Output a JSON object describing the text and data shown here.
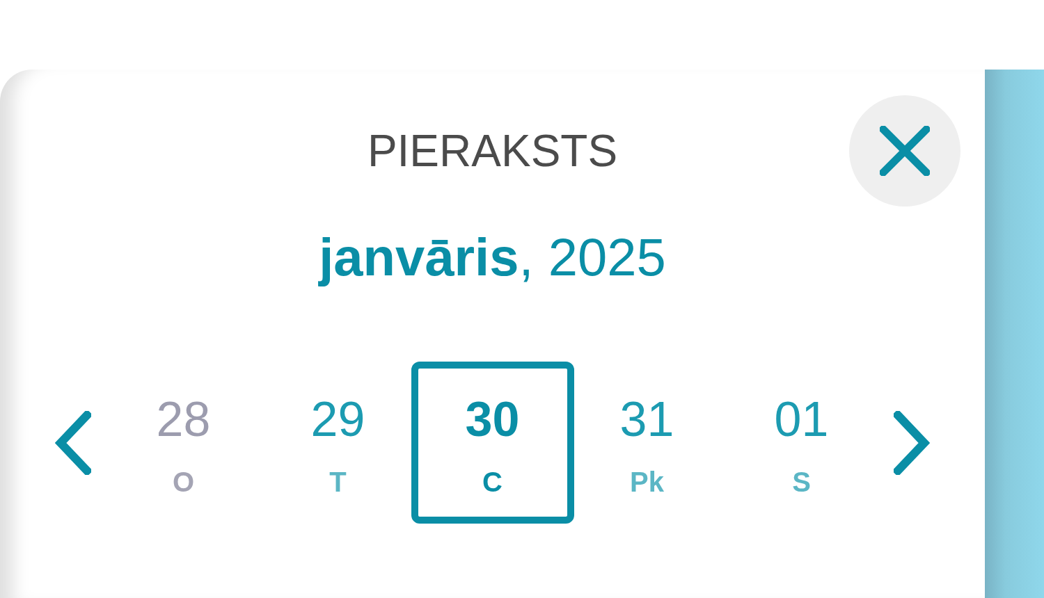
{
  "header": {
    "title": "PIERAKSTS"
  },
  "month_label": "**janvāris**, 2025",
  "days": [
    {
      "number": "28",
      "weekday": "O",
      "selected": false,
      "disabled": true
    },
    {
      "number": "29",
      "weekday": "T",
      "selected": false,
      "disabled": false
    },
    {
      "number": "30",
      "weekday": "C",
      "selected": true,
      "disabled": false
    },
    {
      "number": "31",
      "weekday": "Pk",
      "selected": false,
      "disabled": false
    },
    {
      "number": "01",
      "weekday": "S",
      "selected": false,
      "disabled": false
    }
  ]
}
